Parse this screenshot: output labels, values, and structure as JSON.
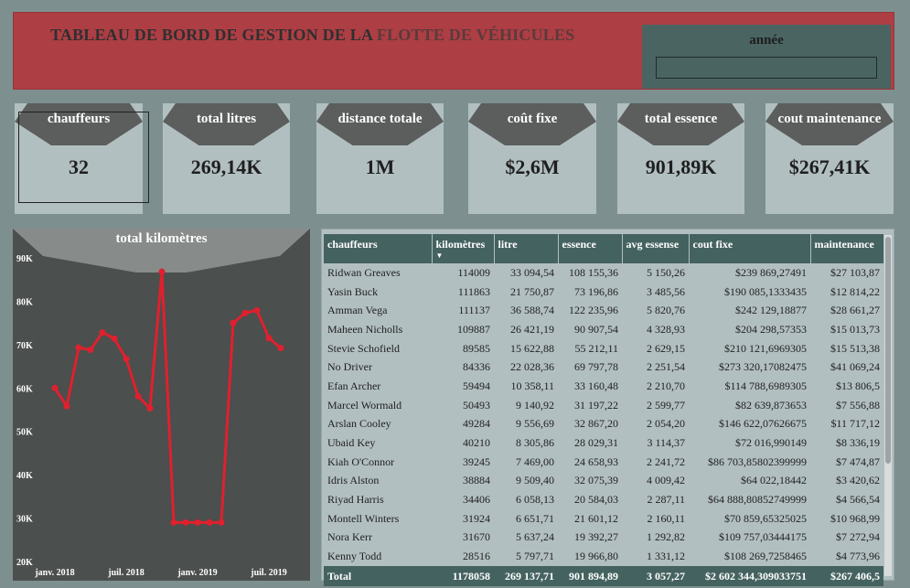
{
  "header": {
    "title_main": "TABLEAU DE BORD DE GESTION DE LA ",
    "title_accent": "FLOTTE DE VÉHICULES",
    "year_label": "année",
    "year_value": ""
  },
  "cards": [
    {
      "label": "chauffeurs",
      "value": "32"
    },
    {
      "label": "total litres",
      "value": "269,14K"
    },
    {
      "label": "distance totale",
      "value": "1M"
    },
    {
      "label": "coût fixe",
      "value": "$2,6M"
    },
    {
      "label": "total essence",
      "value": "901,89K"
    },
    {
      "label": "cout maintenance",
      "value": "$267,41K"
    }
  ],
  "chart_data": {
    "type": "line",
    "title": "total kilomètres",
    "x_tick_labels": [
      "janv. 2018",
      "juil. 2018",
      "janv. 2019",
      "juil. 2019"
    ],
    "y_tick_labels": [
      "90K",
      "80K",
      "70K",
      "60K",
      "50K",
      "40K",
      "30K",
      "20K"
    ],
    "ylim": [
      20000,
      90000
    ],
    "x": [
      "2018-01",
      "2018-02",
      "2018-03",
      "2018-04",
      "2018-05",
      "2018-06",
      "2018-07",
      "2018-08",
      "2018-09",
      "2018-10",
      "2018-11",
      "2018-12",
      "2019-01",
      "2019-02",
      "2019-03",
      "2019-04",
      "2019-05",
      "2019-06",
      "2019-07",
      "2019-08",
      "2019-09"
    ],
    "values": [
      60000,
      55800,
      69300,
      68800,
      72800,
      71400,
      66700,
      58100,
      55300,
      86800,
      29000,
      29000,
      29000,
      29000,
      29000,
      75000,
      77300,
      77900,
      71500,
      69200,
      null
    ],
    "color": "#e0202e"
  },
  "table": {
    "headers": [
      "chauffeurs",
      "kilomètres",
      "litre",
      "essence",
      "avg essense",
      "cout fixe",
      "maintenance"
    ],
    "rows": [
      [
        "Ridwan Greaves",
        "114009",
        "33 094,54",
        "108 155,36",
        "5 150,26",
        "$239 869,27491",
        "$27 103,87"
      ],
      [
        "Yasin Buck",
        "111863",
        "21 750,87",
        "73 196,86",
        "3 485,56",
        "$190 085,1333435",
        "$12 814,22"
      ],
      [
        "Amman Vega",
        "111137",
        "36 588,74",
        "122 235,96",
        "5 820,76",
        "$242 129,18877",
        "$28 661,27"
      ],
      [
        "Maheen Nicholls",
        "109887",
        "26 421,19",
        "90 907,54",
        "4 328,93",
        "$204 298,57353",
        "$15 013,73"
      ],
      [
        "Stevie Schofield",
        "89585",
        "15 622,88",
        "55 212,11",
        "2 629,15",
        "$210 121,6969305",
        "$15 513,38"
      ],
      [
        "No Driver",
        "84336",
        "22 028,36",
        "69 797,78",
        "2 251,54",
        "$273 320,17082475",
        "$41 069,24"
      ],
      [
        "Efan Archer",
        "59494",
        "10 358,11",
        "33 160,48",
        "2 210,70",
        "$114 788,6989305",
        "$13 806,5"
      ],
      [
        "Marcel Wormald",
        "50493",
        "9 140,92",
        "31 197,22",
        "2 599,77",
        "$82 639,873653",
        "$7 556,88"
      ],
      [
        "Arslan Cooley",
        "49284",
        "9 556,69",
        "32 867,20",
        "2 054,20",
        "$146 622,07626675",
        "$11 717,12"
      ],
      [
        "Ubaid Key",
        "40210",
        "8 305,86",
        "28 029,31",
        "3 114,37",
        "$72 016,990149",
        "$8 336,19"
      ],
      [
        "Kiah O'Connor",
        "39245",
        "7 469,00",
        "24 658,93",
        "2 241,72",
        "$86 703,85802399999",
        "$7 474,87"
      ],
      [
        "Idris Alston",
        "38884",
        "9 509,40",
        "32 075,39",
        "4 009,42",
        "$64 022,18442",
        "$3 420,62"
      ],
      [
        "Riyad Harris",
        "34406",
        "6 058,13",
        "20 584,03",
        "2 287,11",
        "$64 888,80852749999",
        "$4 566,54"
      ],
      [
        "Montell Winters",
        "31924",
        "6 651,71",
        "21 601,12",
        "2 160,11",
        "$70 859,65325025",
        "$10 968,99"
      ],
      [
        "Nora Kerr",
        "31670",
        "5 637,24",
        "19 392,27",
        "1 292,82",
        "$109 757,03444175",
        "$7 272,94"
      ],
      [
        "Kenny Todd",
        "28516",
        "5 797,71",
        "19 966,80",
        "1 331,12",
        "$108 269,7258465",
        "$4 773,96"
      ]
    ],
    "total": [
      "Total",
      "1178058",
      "269 137,71",
      "901 894,89",
      "3 057,27",
      "$2 602 344,309033751",
      "$267 406,5"
    ]
  }
}
